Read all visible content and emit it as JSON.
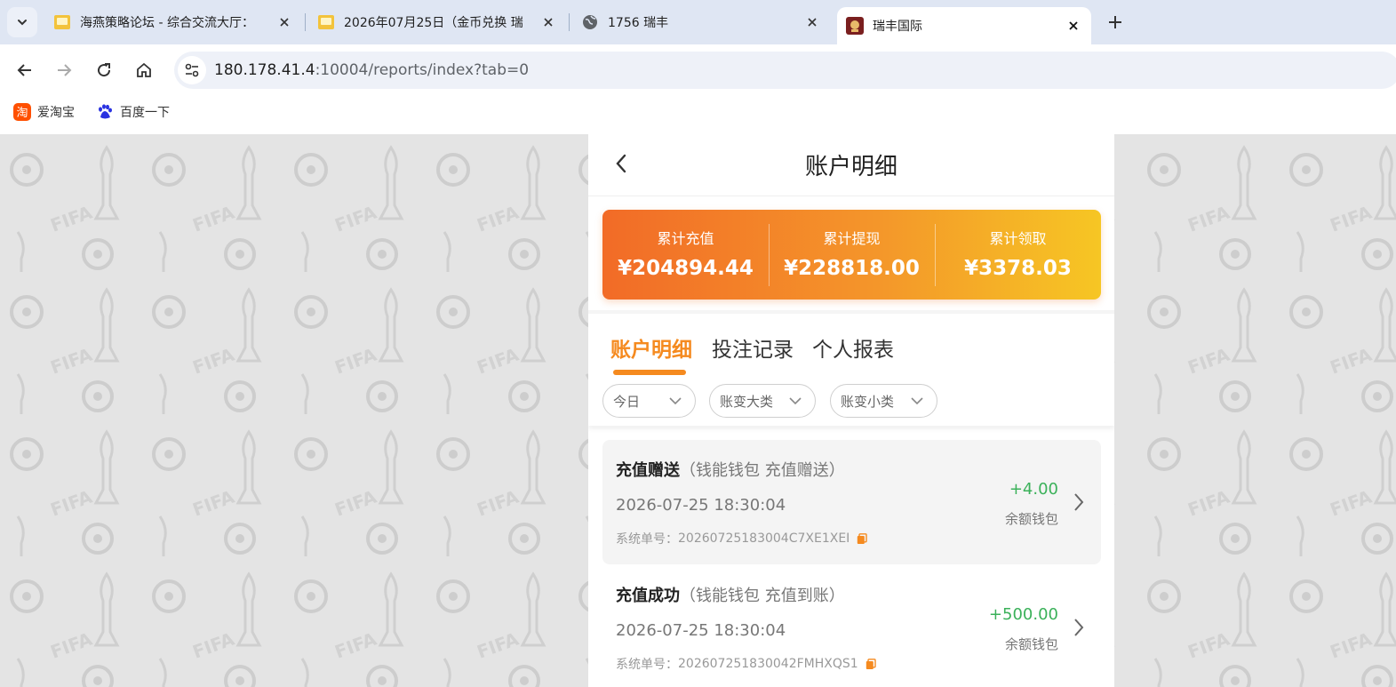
{
  "browser": {
    "tabs": [
      {
        "title": "海燕策略论坛 - 综合交流大厅：",
        "active": false
      },
      {
        "title": "2026年07月25日（金币兑换 瑞",
        "active": false
      },
      {
        "title": "1756 瑞丰",
        "active": false
      },
      {
        "title": "瑞丰国际",
        "active": true
      }
    ],
    "url_host": "180.178.41.4",
    "url_path": ":10004/reports/index?tab=0",
    "bookmarks": [
      {
        "label": "爱淘宝",
        "icon": "taobao-icon"
      },
      {
        "label": "百度一下",
        "icon": "baidu-paw-icon"
      }
    ]
  },
  "page": {
    "title": "账户明细",
    "summary": [
      {
        "label": "累计充值",
        "value": "¥204894.44"
      },
      {
        "label": "累计提现",
        "value": "¥228818.00"
      },
      {
        "label": "累计领取",
        "value": "¥3378.03"
      }
    ],
    "tabs": [
      {
        "label": "账户明细",
        "active": true
      },
      {
        "label": "投注记录",
        "active": false
      },
      {
        "label": "个人报表",
        "active": false
      }
    ],
    "filters": [
      {
        "label": "今日"
      },
      {
        "label": "账变大类"
      },
      {
        "label": "账变小类"
      }
    ],
    "records": [
      {
        "title": "充值赠送",
        "subtitle": "（钱能钱包 充值赠送）",
        "time": "2026-07-25 18:30:04",
        "order_label": "系统单号：",
        "order_no": "20260725183004C7XE1XEI",
        "amount": "+4.00",
        "wallet": "余额钱包"
      },
      {
        "title": "充值成功",
        "subtitle": "（钱能钱包 充值到账）",
        "time": "2026-07-25 18:30:04",
        "order_label": "系统单号：",
        "order_no": "202607251830042FMHXQS1",
        "amount": "+500.00",
        "wallet": "余额钱包"
      }
    ],
    "colors": {
      "accent": "#f58a1f",
      "gradient_start": "#f26b27",
      "gradient_end": "#f6c624",
      "positive": "#3bb15a"
    }
  }
}
